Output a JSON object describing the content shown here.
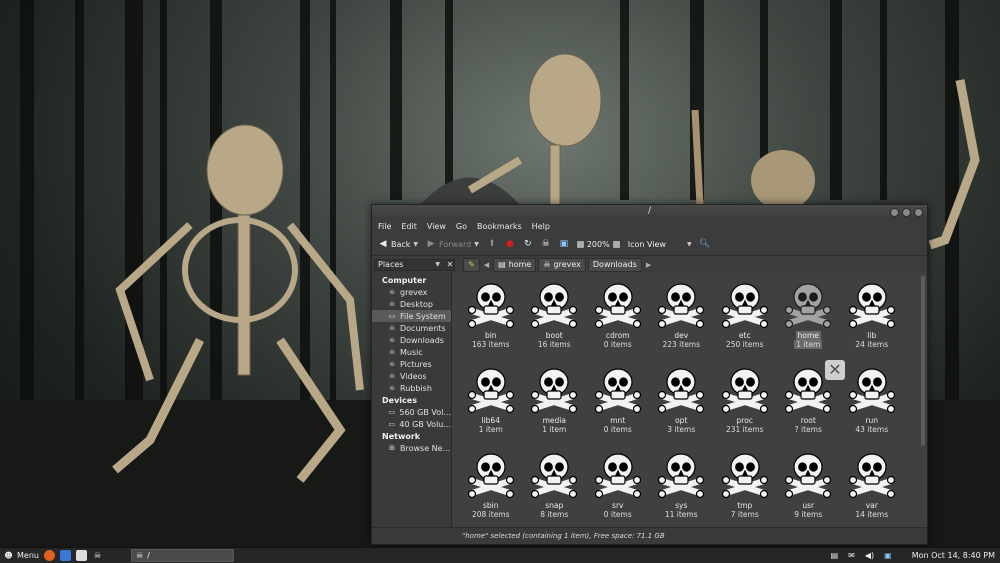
{
  "window": {
    "title": "/",
    "menu": [
      "File",
      "Edit",
      "View",
      "Go",
      "Bookmarks",
      "Help"
    ],
    "toolbar": {
      "back": "Back",
      "forward": "Forward",
      "zoom": "200%",
      "view_mode": "Icon View"
    },
    "sidebar_selector": "Places",
    "breadcrumb": [
      "home",
      "grevex",
      "Downloads"
    ],
    "status": "\"home\" selected (containing 1 item), Free space: 71.1 GB"
  },
  "sidebar": {
    "computer_title": "Computer",
    "computer": [
      "grevex",
      "Desktop",
      "File System",
      "Documents",
      "Downloads",
      "Music",
      "Pictures",
      "Videos",
      "Rubbish"
    ],
    "devices_title": "Devices",
    "devices": [
      "560 GB Vol...",
      "40 GB Volu..."
    ],
    "network_title": "Network",
    "network": [
      "Browse Ne..."
    ]
  },
  "files": [
    {
      "name": "bin",
      "count": "163 items"
    },
    {
      "name": "boot",
      "count": "16 items"
    },
    {
      "name": "cdrom",
      "count": "0 items"
    },
    {
      "name": "dev",
      "count": "223 items"
    },
    {
      "name": "etc",
      "count": "250 items"
    },
    {
      "name": "home",
      "count": "1 item"
    },
    {
      "name": "lib",
      "count": "24 items"
    },
    {
      "name": "lib64",
      "count": "1 item"
    },
    {
      "name": "media",
      "count": "1 item"
    },
    {
      "name": "mnt",
      "count": "0 items"
    },
    {
      "name": "opt",
      "count": "3 items"
    },
    {
      "name": "proc",
      "count": "231 items"
    },
    {
      "name": "root",
      "count": "? items"
    },
    {
      "name": "run",
      "count": "43 items"
    },
    {
      "name": "sbin",
      "count": "208 items"
    },
    {
      "name": "snap",
      "count": "8 items"
    },
    {
      "name": "srv",
      "count": "0 items"
    },
    {
      "name": "sys",
      "count": "11 items"
    },
    {
      "name": "tmp",
      "count": "7 items"
    },
    {
      "name": "usr",
      "count": "9 items"
    },
    {
      "name": "var",
      "count": "14 items"
    }
  ],
  "panel": {
    "menu_label": "Menu",
    "task_label": "/",
    "clock": "Mon Oct 14,  8:40 PM"
  }
}
